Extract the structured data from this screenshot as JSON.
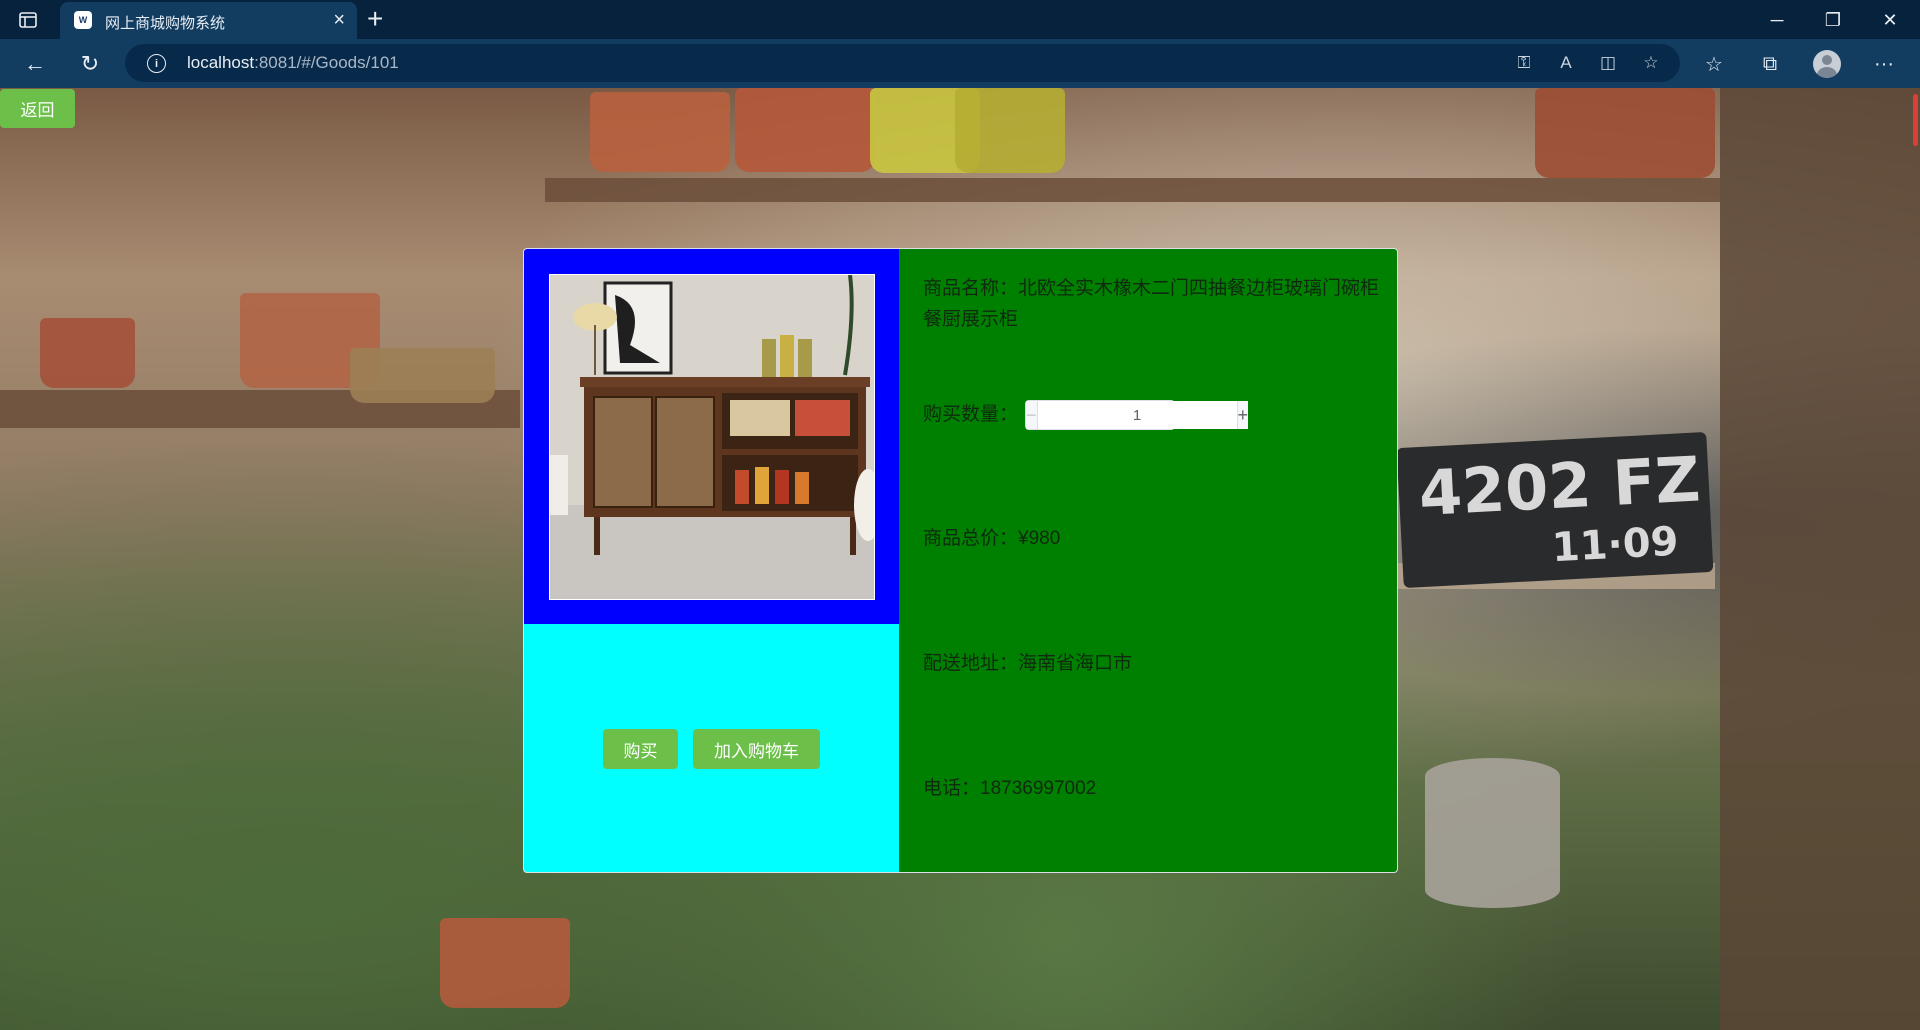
{
  "browser": {
    "tab_title": "网上商城购物系统",
    "tab_icon": "nav-logo-icon",
    "url_host": "localhost",
    "url_rest": ":8081/#/Goods/101"
  },
  "page": {
    "back_label": "返回",
    "background_plate_text_1": "4202 FZ",
    "background_plate_text_2": "11·09"
  },
  "goods": {
    "name_label": "商品名称：",
    "name_value": "北欧全实木橡木二门四抽餐边柜玻璃门碗柜餐厨展示柜",
    "quantity_label": "购买数量：",
    "quantity_value": "1",
    "total_label": "商品总价：",
    "total_value": "¥980",
    "address_label": "配送地址：",
    "address_value": "海南省海口市",
    "phone_label": "电话：",
    "phone_value": "18736997002"
  },
  "actions": {
    "buy_label": "购买",
    "add_cart_label": "加入购物车"
  },
  "colors": {
    "image_panel": "#0000ff",
    "action_panel": "#00ffff",
    "info_panel": "#008000",
    "button": "#6cc04a"
  }
}
